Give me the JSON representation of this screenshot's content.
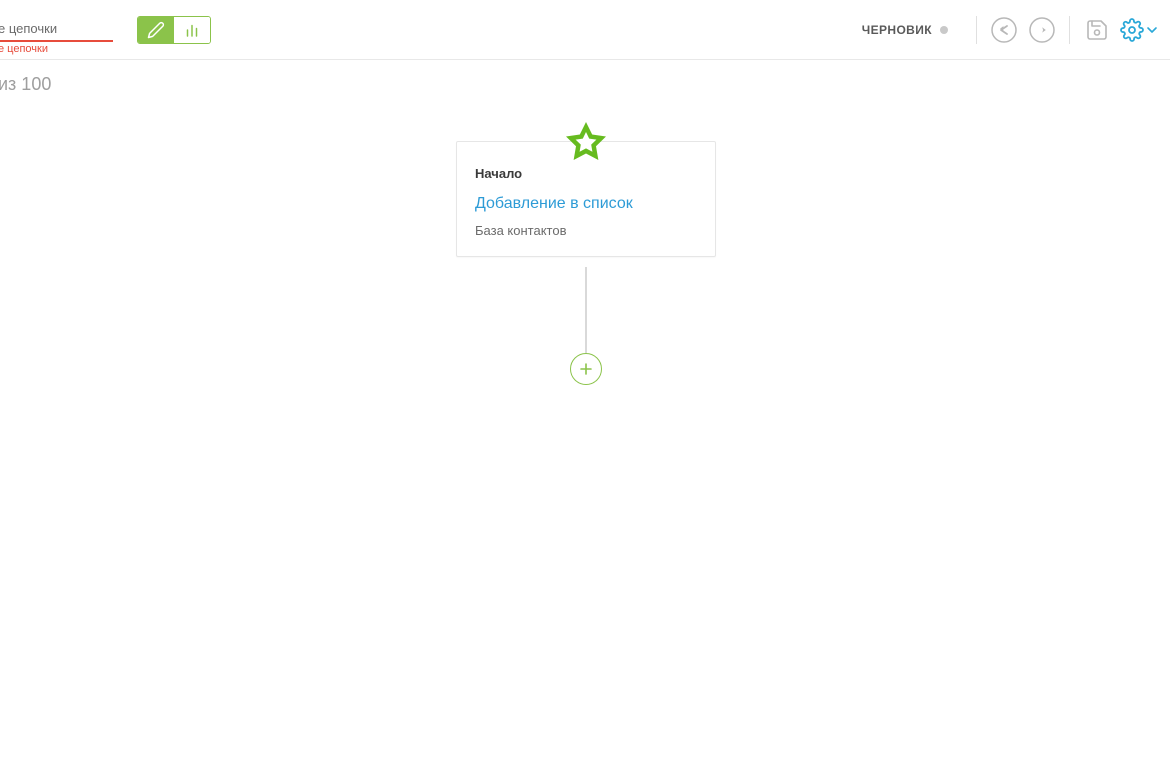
{
  "header": {
    "chain_name_label": "е цепочки",
    "chain_name_error": "е цепочки",
    "status": "ЧЕРНОВИК"
  },
  "subheader": {
    "counter": "из 100"
  },
  "node": {
    "title": "Начало",
    "action": "Добавление в список",
    "subtitle": "База контактов"
  },
  "colors": {
    "accent_green": "#8bc34a",
    "accent_blue": "#2d9bd6",
    "error_red": "#e74c3c",
    "gear_blue": "#2aa8d8",
    "muted_gray": "#9e9e9e",
    "icon_gray": "#b8b8b8"
  }
}
